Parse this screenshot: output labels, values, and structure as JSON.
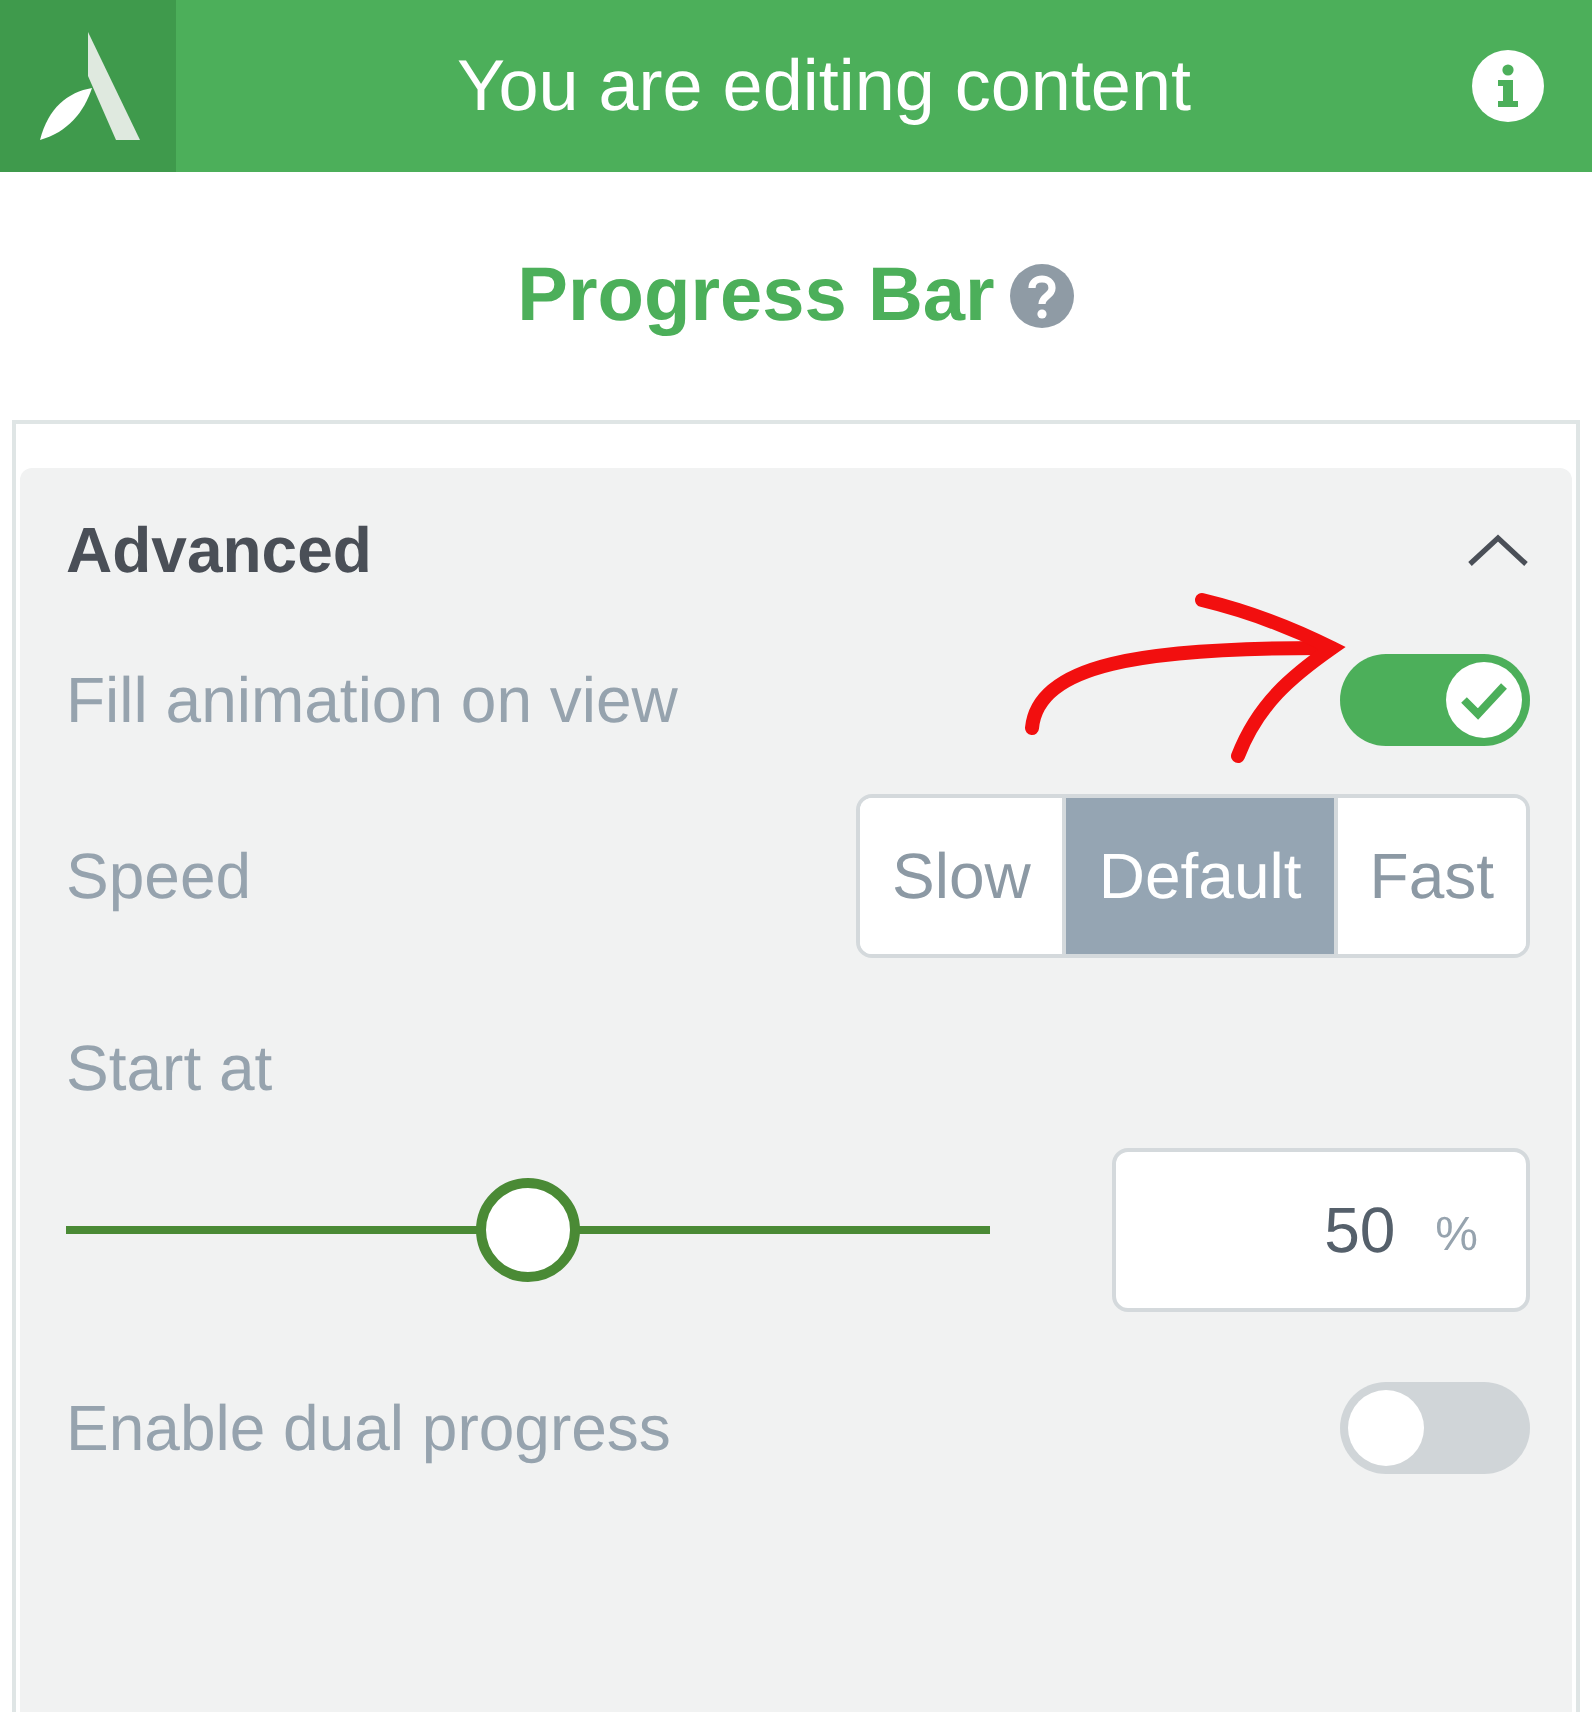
{
  "header": {
    "title": "You are editing content"
  },
  "element": {
    "title": "Progress Bar"
  },
  "section": {
    "title": "Advanced",
    "expanded": true
  },
  "settings": [
    {
      "kind": "toggle",
      "label": "Fill animation on view",
      "on": true
    },
    {
      "kind": "segmented",
      "label": "Speed",
      "options": [
        {
          "label": "Slow",
          "selected": false
        },
        {
          "label": "Default",
          "selected": true
        },
        {
          "label": "Fast",
          "selected": false
        }
      ]
    },
    {
      "kind": "slider",
      "label": "Start at",
      "level": 0.5,
      "value": "50",
      "unit": "%"
    },
    {
      "kind": "toggle",
      "label": "Enable dual progress",
      "on": false
    }
  ]
}
